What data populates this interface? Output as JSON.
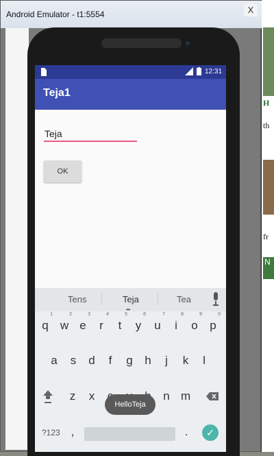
{
  "window": {
    "title": "Android Emulator - t1:5554",
    "close_glyph": "X"
  },
  "status_bar": {
    "time": "12:31"
  },
  "app": {
    "title": "Teja1"
  },
  "form": {
    "text_value": "Teja",
    "ok_label": "OK"
  },
  "keyboard": {
    "suggestions": [
      "Tens",
      "Teja",
      "Tea"
    ],
    "row1": [
      "q",
      "w",
      "e",
      "r",
      "t",
      "y",
      "u",
      "i",
      "o",
      "p"
    ],
    "row1_numbers": [
      "1",
      "2",
      "3",
      "4",
      "5",
      "6",
      "7",
      "8",
      "9",
      "0"
    ],
    "row2": [
      "a",
      "s",
      "d",
      "f",
      "g",
      "h",
      "j",
      "k",
      "l"
    ],
    "row3": [
      "z",
      "x",
      "c",
      "v",
      "b",
      "n",
      "m"
    ],
    "symbols_key": "?123",
    "comma": ",",
    "period": "."
  },
  "toast": {
    "text": "HelloTeja"
  },
  "background_fragments": {
    "letter_h": "H",
    "text_th": "th",
    "text_fr": "fr",
    "letter_n": "N"
  },
  "icons": [
    "sim-card-icon",
    "signal-icon",
    "battery-icon",
    "mic-icon",
    "shift-icon",
    "backspace-icon",
    "check-icon",
    "close-icon"
  ]
}
